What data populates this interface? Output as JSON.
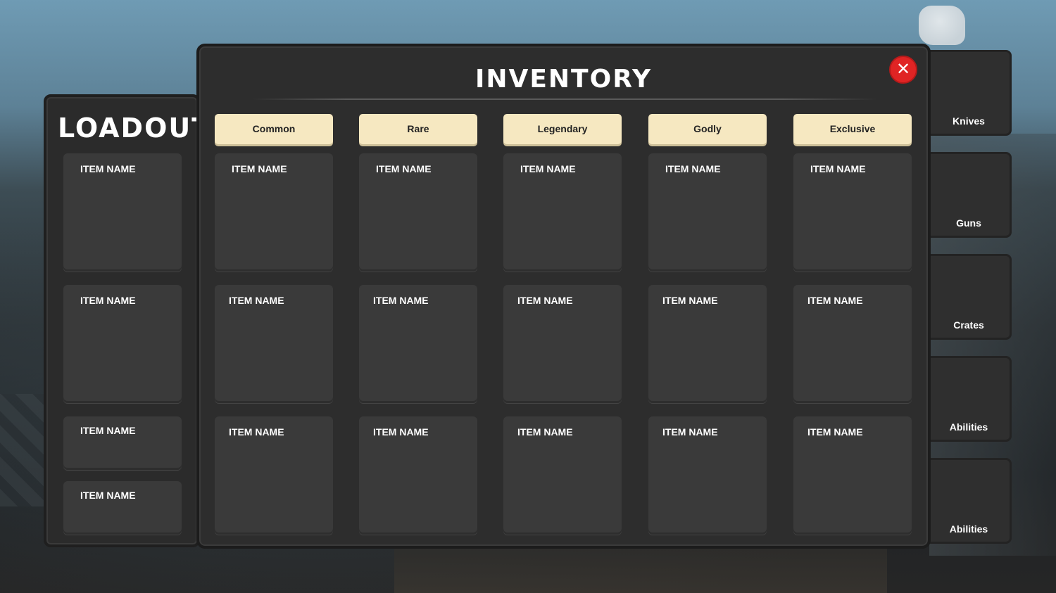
{
  "loadout": {
    "title": "LOADOUT",
    "slots": [
      {
        "label": "ITEM NAME"
      },
      {
        "label": "ITEM NAME"
      },
      {
        "label": "ITEM NAME"
      },
      {
        "label": "ITEM NAME"
      }
    ]
  },
  "inventory": {
    "title": "INVENTORY",
    "close_icon": "x-close-icon",
    "tabs": [
      "Common",
      "Rare",
      "Legendary",
      "Godly",
      "Exclusive"
    ],
    "grid": [
      [
        "ITEM NAME",
        "ITEM NAME",
        "ITEM NAME",
        "ITEM NAME",
        "ITEM NAME"
      ],
      [
        "ITEM NAME",
        "ITEM NAME",
        "ITEM NAME",
        "ITEM NAME",
        "ITEM NAME"
      ],
      [
        "ITEM NAME",
        "ITEM NAME",
        "ITEM NAME",
        "ITEM NAME",
        "ITEM NAME"
      ]
    ]
  },
  "categories": [
    "Knives",
    "Guns",
    "Crates",
    "Abilities",
    "Abilities"
  ],
  "colors": {
    "tab_bg": "#f6e8c1",
    "panel_bg": "#2d2d2d",
    "slot_bg": "#3a3a3a",
    "close_bg": "#e02424"
  }
}
